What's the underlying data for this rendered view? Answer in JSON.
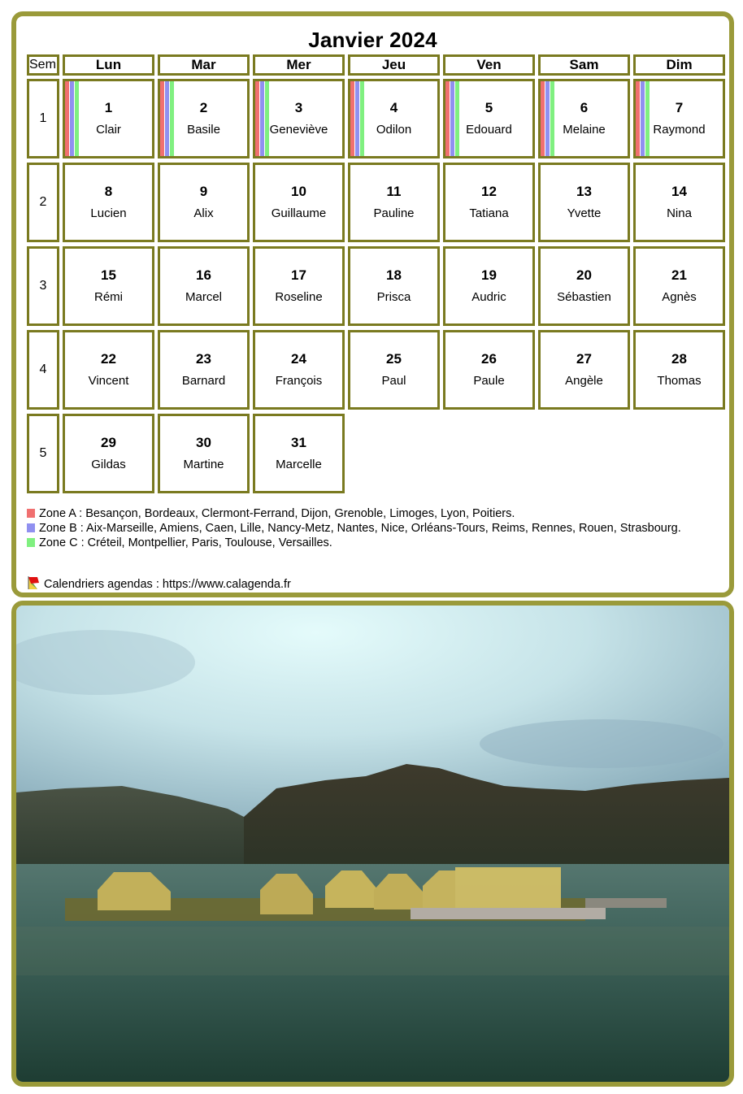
{
  "calendar": {
    "title": "Janvier 2024",
    "week_header": "Sem",
    "weekdays": [
      "Lun",
      "Mar",
      "Mer",
      "Jeu",
      "Ven",
      "Sam",
      "Dim"
    ],
    "weeks": [
      {
        "num": "1",
        "days": [
          {
            "day": "1",
            "name": "Clair",
            "holiday": true
          },
          {
            "day": "2",
            "name": "Basile",
            "holiday": true
          },
          {
            "day": "3",
            "name": "Geneviève",
            "holiday": true
          },
          {
            "day": "4",
            "name": "Odilon",
            "holiday": true
          },
          {
            "day": "5",
            "name": "Edouard",
            "holiday": true
          },
          {
            "day": "6",
            "name": "Melaine",
            "holiday": true
          },
          {
            "day": "7",
            "name": "Raymond",
            "holiday": true
          }
        ]
      },
      {
        "num": "2",
        "days": [
          {
            "day": "8",
            "name": "Lucien"
          },
          {
            "day": "9",
            "name": "Alix"
          },
          {
            "day": "10",
            "name": "Guillaume"
          },
          {
            "day": "11",
            "name": "Pauline"
          },
          {
            "day": "12",
            "name": "Tatiana"
          },
          {
            "day": "13",
            "name": "Yvette"
          },
          {
            "day": "14",
            "name": "Nina"
          }
        ]
      },
      {
        "num": "3",
        "days": [
          {
            "day": "15",
            "name": "Rémi"
          },
          {
            "day": "16",
            "name": "Marcel"
          },
          {
            "day": "17",
            "name": "Roseline"
          },
          {
            "day": "18",
            "name": "Prisca"
          },
          {
            "day": "19",
            "name": "Audric"
          },
          {
            "day": "20",
            "name": "Sébastien"
          },
          {
            "day": "21",
            "name": "Agnès"
          }
        ]
      },
      {
        "num": "4",
        "days": [
          {
            "day": "22",
            "name": "Vincent"
          },
          {
            "day": "23",
            "name": "Barnard"
          },
          {
            "day": "24",
            "name": "François"
          },
          {
            "day": "25",
            "name": "Paul"
          },
          {
            "day": "26",
            "name": "Paule"
          },
          {
            "day": "27",
            "name": "Angèle"
          },
          {
            "day": "28",
            "name": "Thomas"
          }
        ]
      },
      {
        "num": "5",
        "days": [
          {
            "day": "29",
            "name": "Gildas"
          },
          {
            "day": "30",
            "name": "Martine"
          },
          {
            "day": "31",
            "name": "Marcelle"
          }
        ]
      }
    ]
  },
  "zones": [
    {
      "id": "A",
      "color": "#f07070",
      "text": "Zone A : Besançon, Bordeaux, Clermont-Ferrand, Dijon, Grenoble, Limoges, Lyon, Poitiers."
    },
    {
      "id": "B",
      "color": "#9090f0",
      "text": "Zone B : Aix-Marseille, Amiens, Caen, Lille, Nancy-Metz, Nantes, Nice, Orléans-Tours, Reims, Rennes, Rouen, Strasbourg."
    },
    {
      "id": "C",
      "color": "#80f080",
      "text": "Zone C : Créteil, Montpellier, Paris, Toulouse, Versailles."
    }
  ],
  "credit": {
    "icon": "calagenda-flag-icon",
    "text": "Calendriers agendas : https://www.calagenda.fr"
  },
  "photo": {
    "subject": "reed-huts-on-lake-with-mountains"
  },
  "colors": {
    "frame": "#9a9a3a",
    "cell_border": "#7a7a20"
  }
}
